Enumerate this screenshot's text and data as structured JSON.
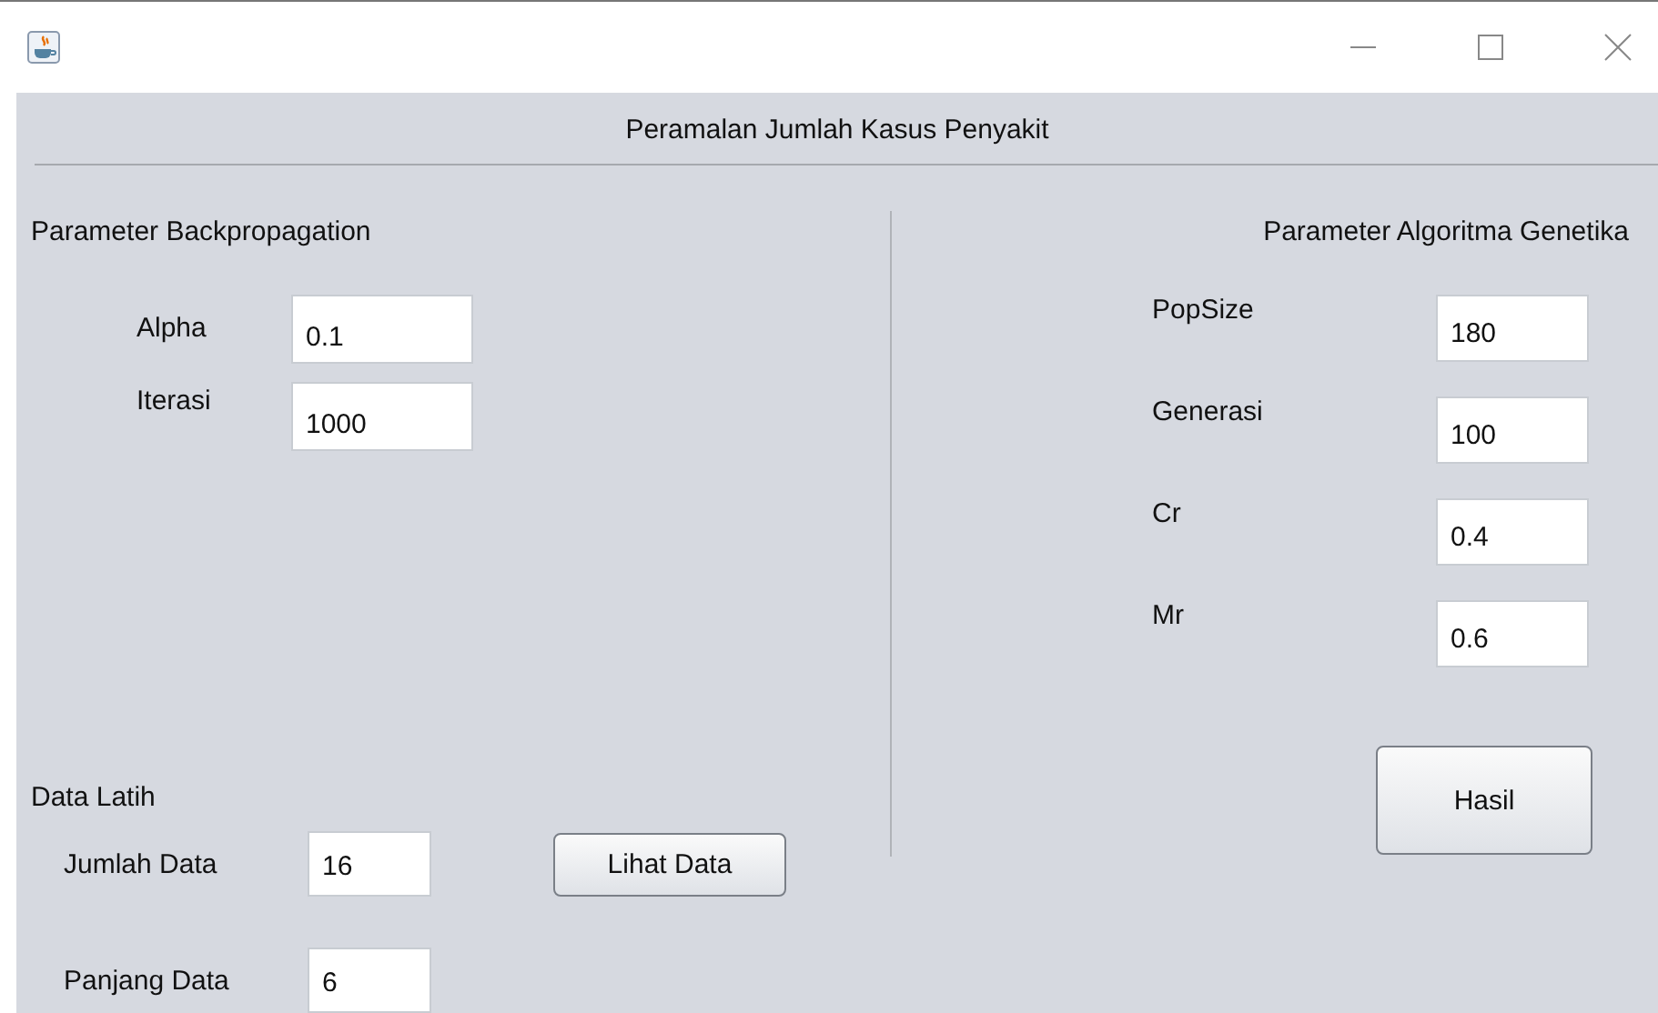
{
  "window": {
    "title": "Peramalan Jumlah Kasus Penyakit"
  },
  "backpropagation": {
    "heading": "Parameter Backpropagation",
    "params": [
      {
        "label": "Alpha",
        "value": "0.1"
      },
      {
        "label": "Iterasi",
        "value": "1000"
      }
    ]
  },
  "training_data": {
    "heading": "Data Latih",
    "params": [
      {
        "label": "Jumlah Data",
        "value": "16"
      },
      {
        "label": "Panjang Data",
        "value": "6"
      }
    ],
    "button": "Lihat Data"
  },
  "genetic": {
    "heading": "Parameter Algoritma Genetika",
    "params": [
      {
        "label": "PopSize",
        "value": "180"
      },
      {
        "label": "Generasi",
        "value": "100"
      },
      {
        "label": "Cr",
        "value": "0.4"
      },
      {
        "label": "Mr",
        "value": "0.6"
      }
    ],
    "button": "Hasil"
  }
}
